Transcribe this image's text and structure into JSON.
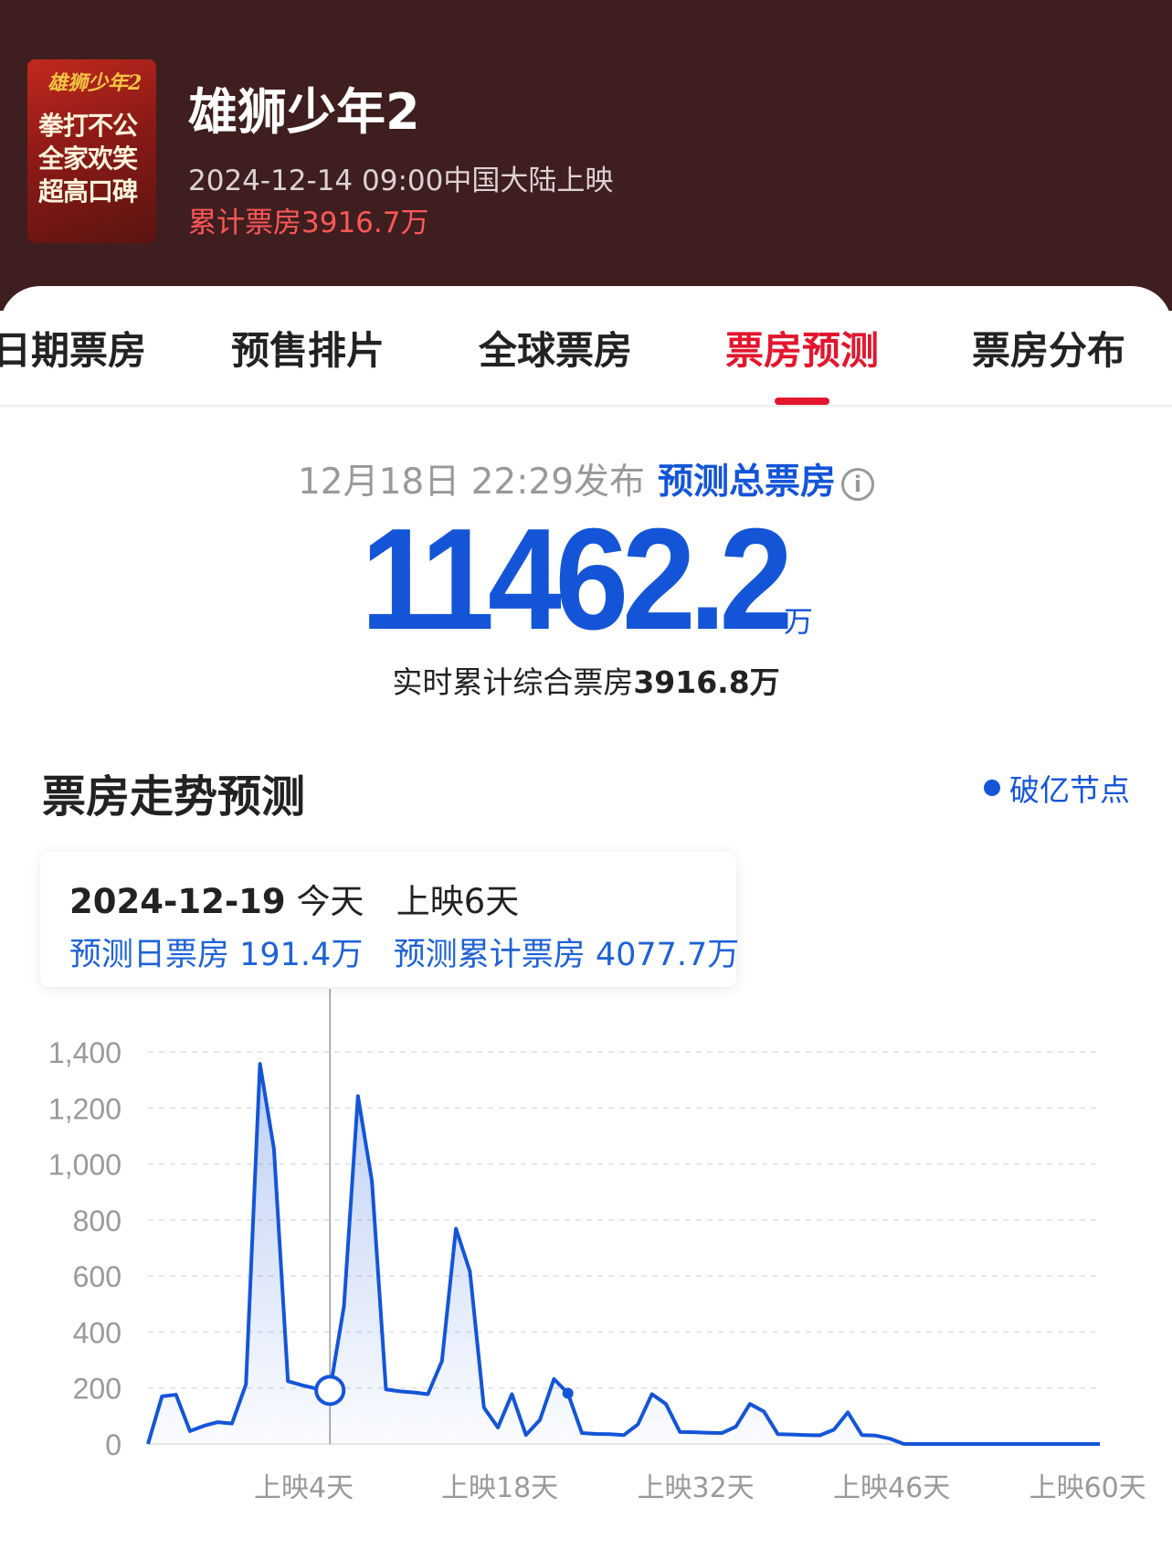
{
  "movie": {
    "title": "雄狮少年2",
    "release": "2024-12-14 09:00中国大陆上映",
    "gross": "累计票房3916.7万",
    "poster": {
      "top_text": "雄狮少年2",
      "lines": [
        "拳打不公",
        "全家欢笑",
        "超高口碑"
      ]
    }
  },
  "tabs": [
    "日期票房",
    "预售排片",
    "全球票房",
    "票房预测",
    "票房分布"
  ],
  "active_tab": "票房预测",
  "forecast": {
    "published": "12月18日 22:29发布",
    "label": "预测总票房",
    "info_icon": "i",
    "total": "11462.2",
    "unit": "万",
    "realtime_label": "实时累计综合票房",
    "realtime_value": "3916.8万"
  },
  "trend": {
    "title": "票房走势预测",
    "legend": "破亿节点",
    "tooltip": {
      "date": "2024-12-19",
      "today": "今天",
      "day": "上映6天",
      "daily": "预测日票房 191.4万",
      "cumulative": "预测累计票房 4077.7万"
    }
  },
  "colors": {
    "header": "#3f1e1f",
    "accent": "#e3162d",
    "blue": "#1455d8"
  },
  "chart_data": {
    "type": "area",
    "title": "票房走势预测",
    "xlabel": "",
    "ylabel": "万",
    "ylim": [
      0,
      1400
    ],
    "yticks": [
      "0",
      "200",
      "400",
      "600",
      "800",
      "1,000",
      "1,200",
      "1,400"
    ],
    "ytick_values": [
      0,
      200,
      400,
      600,
      800,
      1000,
      1200,
      1400
    ],
    "xtick_labels": [
      "上映4天",
      "上映18天",
      "上映32天",
      "上映46天",
      "上映60天"
    ],
    "xtick_days": [
      4,
      18,
      32,
      46,
      60
    ],
    "x_start_day": -7,
    "highlight_day": 6,
    "milestone_day": 23,
    "values": [
      0,
      170,
      176,
      46,
      65,
      78,
      73,
      213,
      1357,
      1053,
      224,
      210,
      198,
      191.4,
      492,
      1242,
      938,
      195,
      188,
      184,
      178,
      296,
      769,
      616,
      130,
      59,
      178,
      32,
      86,
      232,
      181,
      39,
      36,
      35,
      32,
      70,
      178,
      143,
      43,
      42,
      40,
      39,
      62,
      143,
      116,
      35,
      34,
      32,
      31,
      51,
      113,
      32,
      30,
      19,
      0,
      0,
      0,
      0,
      0,
      0,
      0,
      0,
      0,
      0,
      0,
      0,
      0,
      0,
      0
    ]
  }
}
